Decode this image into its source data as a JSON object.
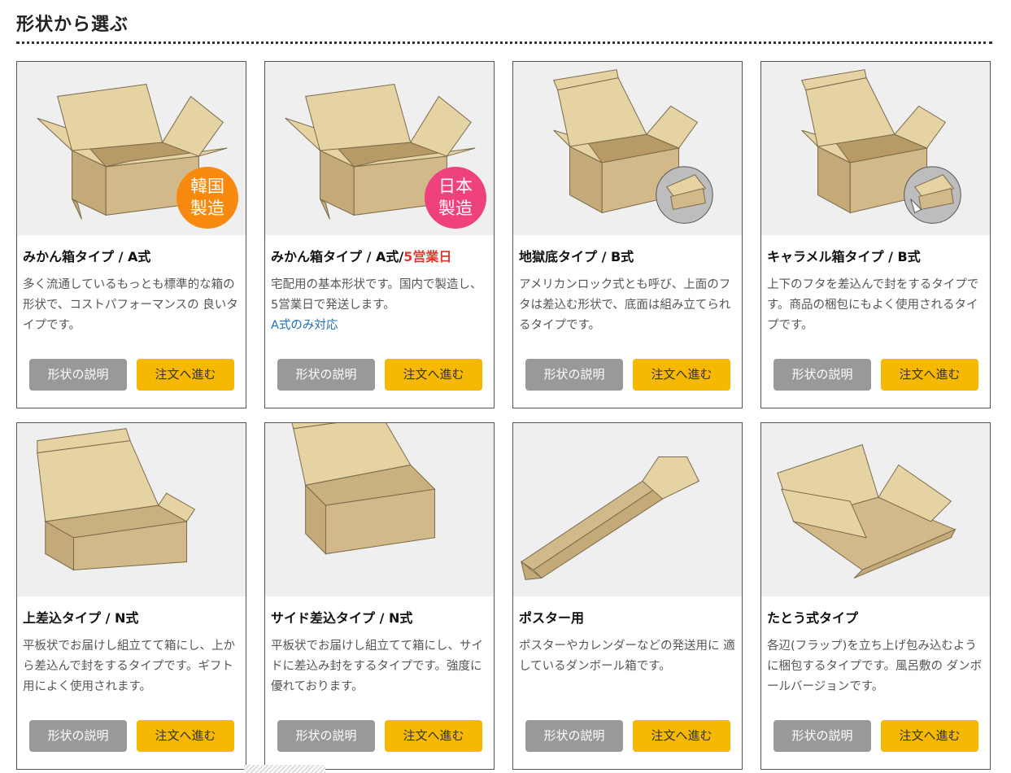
{
  "section": {
    "title": "形状から選ぶ"
  },
  "colors": {
    "accent": "#f6b800",
    "gray_button": "#999999",
    "highlight": "#e03a2f",
    "link": "#1d6fb8"
  },
  "cards": [
    {
      "name": "みかん箱タイプ / A式",
      "name_highlight": "",
      "desc": "多く流通しているもっとも標準的な箱の形状で、コストパフォーマンスの 良いタイプです。",
      "desc_link": "",
      "badge": [
        "韓国",
        "製造"
      ],
      "badge_color": "#f7890f",
      "icon": "a-type-box-icon",
      "explain_label": "形状の説明",
      "order_label": "注文へ進む"
    },
    {
      "name": "みかん箱タイプ / A式/",
      "name_highlight": "5営業日",
      "desc": "宅配用の基本形状です。国内で製造し、5営業日で発送します。",
      "desc_link": "A式のみ対応",
      "badge": [
        "日本",
        "製造"
      ],
      "badge_color": "#f0417f",
      "icon": "a-type-box-icon",
      "explain_label": "形状の説明",
      "order_label": "注文へ進む"
    },
    {
      "name": "地獄底タイプ / B式",
      "name_highlight": "",
      "desc": "アメリカンロック式とも呼び、上面のフタは差込む形状で、底面は組み立てられるタイプです。",
      "desc_link": "",
      "badge": [],
      "badge_color": "",
      "icon": "b-type-lock-bottom-box-icon",
      "explain_label": "形状の説明",
      "order_label": "注文へ進む"
    },
    {
      "name": "キャラメル箱タイプ / B式",
      "name_highlight": "",
      "desc": "上下のフタを差込んで封をするタイプです。商品の梱包にもよく使用されるタイプです。",
      "desc_link": "",
      "badge": [],
      "badge_color": "",
      "icon": "b-type-caramel-box-icon",
      "explain_label": "形状の説明",
      "order_label": "注文へ進む"
    },
    {
      "name": "上差込タイプ / N式",
      "name_highlight": "",
      "desc": "平板状でお届けし組立てて箱にし、上から差込んで封をするタイプです。ギフト用によく使用されます。",
      "desc_link": "",
      "badge": [],
      "badge_color": "",
      "icon": "n-type-top-insert-box-icon",
      "explain_label": "形状の説明",
      "order_label": "注文へ進む"
    },
    {
      "name": "サイド差込タイプ / N式",
      "name_highlight": "",
      "desc": "平板状でお届けし組立てて箱にし、サイドに差込み封をするタイプです。強度に優れております。",
      "desc_link": "",
      "badge": [],
      "badge_color": "",
      "icon": "n-type-side-insert-box-icon",
      "explain_label": "形状の説明",
      "order_label": "注文へ進む"
    },
    {
      "name": "ポスター用",
      "name_highlight": "",
      "desc": "ポスターやカレンダーなどの発送用に 適しているダンボール箱です。",
      "desc_link": "",
      "badge": [],
      "badge_color": "",
      "icon": "poster-tube-box-icon",
      "explain_label": "形状の説明",
      "order_label": "注文へ進む"
    },
    {
      "name": "たとう式タイプ",
      "name_highlight": "",
      "desc": "各辺(フラップ)を立ち上げ包み込むように梱包するタイプです。風呂敷の ダンボールバージョンです。",
      "desc_link": "",
      "badge": [],
      "badge_color": "",
      "icon": "tatou-wrap-box-icon",
      "explain_label": "形状の説明",
      "order_label": "注文へ進む"
    }
  ]
}
